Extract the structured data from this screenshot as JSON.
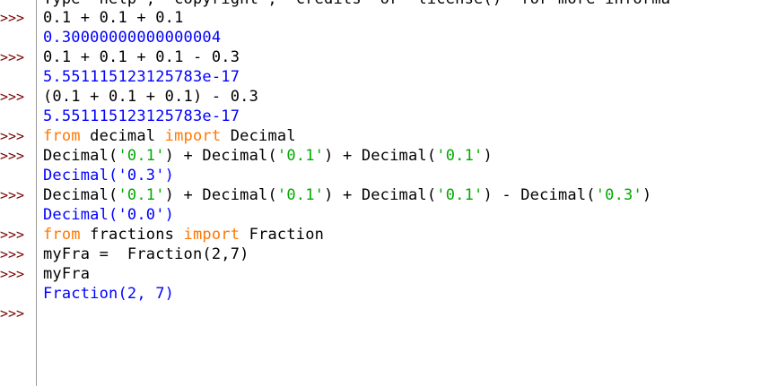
{
  "prompt_text": ">>>",
  "prompts": [
    {
      "row": 0,
      "text": ">>>"
    },
    {
      "row": 2,
      "text": ">>>"
    },
    {
      "row": 4,
      "text": ">>>"
    },
    {
      "row": 6,
      "text": ">>>"
    },
    {
      "row": 7,
      "text": ">>>"
    },
    {
      "row": 9,
      "text": ">>>"
    },
    {
      "row": 11,
      "text": ">>>"
    },
    {
      "row": 12,
      "text": ">>>"
    },
    {
      "row": 13,
      "text": ">>>"
    },
    {
      "row": 15,
      "text": ">>>"
    }
  ],
  "header_line": "Type \"help\", \"copyright\", \"credits\" or \"license()\" for more informa",
  "lines": [
    {
      "kind": "input",
      "tokens": [
        {
          "t": "plain",
          "s": "0.1 + 0.1 + 0.1"
        }
      ]
    },
    {
      "kind": "output",
      "tokens": [
        {
          "t": "out",
          "s": "0.30000000000000004"
        }
      ]
    },
    {
      "kind": "input",
      "tokens": [
        {
          "t": "plain",
          "s": "0.1 + 0.1 + 0.1 - 0.3"
        }
      ]
    },
    {
      "kind": "output",
      "tokens": [
        {
          "t": "out",
          "s": "5.551115123125783e-17"
        }
      ]
    },
    {
      "kind": "input",
      "tokens": [
        {
          "t": "plain",
          "s": "(0.1 + 0.1 + 0.1) - 0.3"
        }
      ]
    },
    {
      "kind": "output",
      "tokens": [
        {
          "t": "out",
          "s": "5.551115123125783e-17"
        }
      ]
    },
    {
      "kind": "input",
      "tokens": [
        {
          "t": "kw",
          "s": "from"
        },
        {
          "t": "plain",
          "s": " decimal "
        },
        {
          "t": "kw",
          "s": "import"
        },
        {
          "t": "plain",
          "s": " Decimal"
        }
      ]
    },
    {
      "kind": "input",
      "tokens": [
        {
          "t": "plain",
          "s": "Decimal("
        },
        {
          "t": "str",
          "s": "'0.1'"
        },
        {
          "t": "plain",
          "s": ") + Decimal("
        },
        {
          "t": "str",
          "s": "'0.1'"
        },
        {
          "t": "plain",
          "s": ") + Decimal("
        },
        {
          "t": "str",
          "s": "'0.1'"
        },
        {
          "t": "plain",
          "s": ")"
        }
      ]
    },
    {
      "kind": "output",
      "tokens": [
        {
          "t": "out",
          "s": "Decimal('0.3')"
        }
      ]
    },
    {
      "kind": "input",
      "tokens": [
        {
          "t": "plain",
          "s": "Decimal("
        },
        {
          "t": "str",
          "s": "'0.1'"
        },
        {
          "t": "plain",
          "s": ") + Decimal("
        },
        {
          "t": "str",
          "s": "'0.1'"
        },
        {
          "t": "plain",
          "s": ") + Decimal("
        },
        {
          "t": "str",
          "s": "'0.1'"
        },
        {
          "t": "plain",
          "s": ") - Decimal("
        },
        {
          "t": "str",
          "s": "'0.3'"
        },
        {
          "t": "plain",
          "s": ")"
        }
      ]
    },
    {
      "kind": "output",
      "tokens": [
        {
          "t": "out",
          "s": "Decimal('0.0')"
        }
      ]
    },
    {
      "kind": "input",
      "tokens": [
        {
          "t": "kw",
          "s": "from"
        },
        {
          "t": "plain",
          "s": " fractions "
        },
        {
          "t": "kw",
          "s": "import"
        },
        {
          "t": "plain",
          "s": " Fraction"
        }
      ]
    },
    {
      "kind": "input",
      "tokens": [
        {
          "t": "plain",
          "s": "myFra =  Fraction(2,7)"
        }
      ]
    },
    {
      "kind": "input",
      "tokens": [
        {
          "t": "plain",
          "s": "myFra"
        }
      ]
    },
    {
      "kind": "output",
      "tokens": [
        {
          "t": "out",
          "s": "Fraction(2, 7)"
        }
      ]
    },
    {
      "kind": "input",
      "tokens": []
    }
  ],
  "colors": {
    "prompt": "#7a0000",
    "keyword": "#ff7700",
    "string": "#00aa00",
    "output": "#0000ff",
    "text": "#000000",
    "gutter_separator": "#9a9a9a",
    "background": "#ffffff"
  }
}
